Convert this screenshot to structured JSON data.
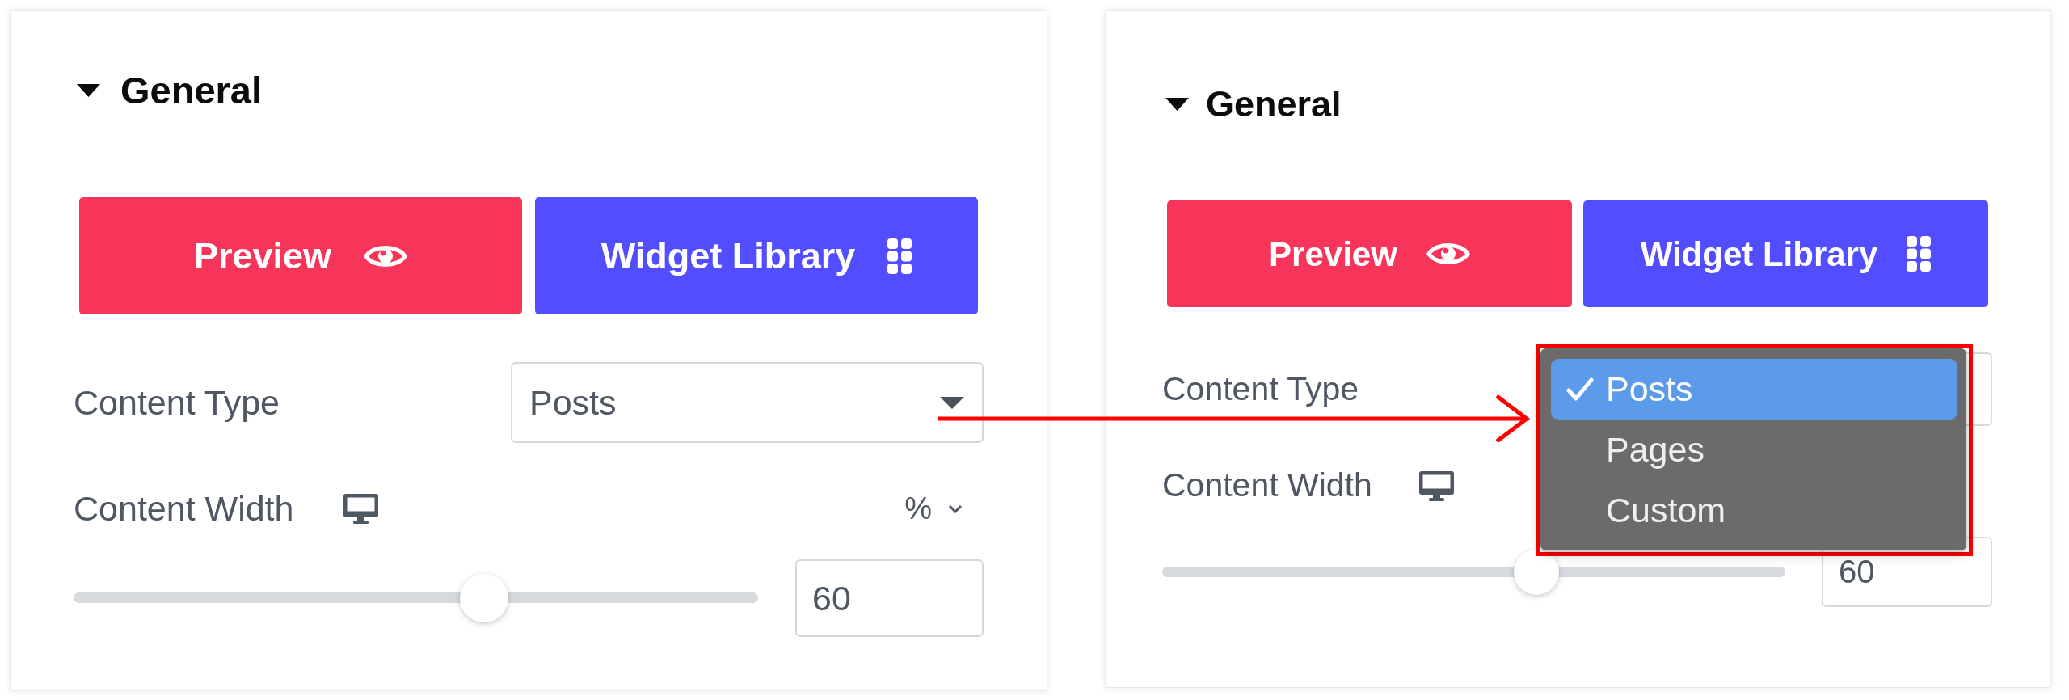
{
  "panels": [
    {
      "section": {
        "title": "General",
        "expanded": true
      },
      "buttons": [
        {
          "label": "Preview",
          "kind": "preview"
        },
        {
          "label": "Widget Library",
          "kind": "library"
        }
      ],
      "content_type": {
        "label": "Content Type",
        "value": "Posts",
        "open": false
      },
      "content_width": {
        "label": "Content Width",
        "unit": "%",
        "level": 0.6,
        "value": "60"
      }
    },
    {
      "section": {
        "title": "General",
        "expanded": true
      },
      "buttons": [
        {
          "label": "Preview",
          "kind": "preview"
        },
        {
          "label": "Widget Library",
          "kind": "library"
        }
      ],
      "content_type": {
        "label": "Content Type",
        "open": true,
        "options": [
          {
            "label": "Posts",
            "selected": true
          },
          {
            "label": "Pages",
            "selected": false
          },
          {
            "label": "Custom",
            "selected": false
          }
        ]
      },
      "content_width": {
        "label": "Content Width",
        "level": 0.6,
        "value": "60"
      }
    }
  ]
}
